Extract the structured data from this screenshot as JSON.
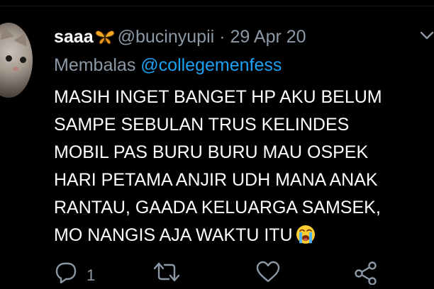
{
  "tweet": {
    "display_name": "saaa",
    "handle": "@bucinyupii",
    "separator": "·",
    "date": "29 Apr 20",
    "reply_label": "Membalas",
    "reply_to": "@collegemenfess",
    "text_lines": [
      "MASIH INGET BANGET HP AKU BELUM",
      "SAMPE SEBULAN TRUS KELINDES",
      "MOBIL PAS BURU BURU MAU OSPEK",
      "HARI PETAMA ANJIR UDH MANA ANAK",
      "RANTAU, GAADA KELUARGA SAMSEK,",
      "MO NANGIS AJA WAKTU ITU"
    ],
    "name_emoji": "butterfly-icon",
    "end_emoji": "loudly-crying-face-icon"
  },
  "actions": {
    "reply_count": "1",
    "icons": [
      "reply-icon",
      "retweet-icon",
      "like-icon",
      "share-icon"
    ]
  },
  "colors": {
    "background": "#000000",
    "text": "#ffffff",
    "muted": "#8b98a5",
    "link": "#1da1f2"
  }
}
